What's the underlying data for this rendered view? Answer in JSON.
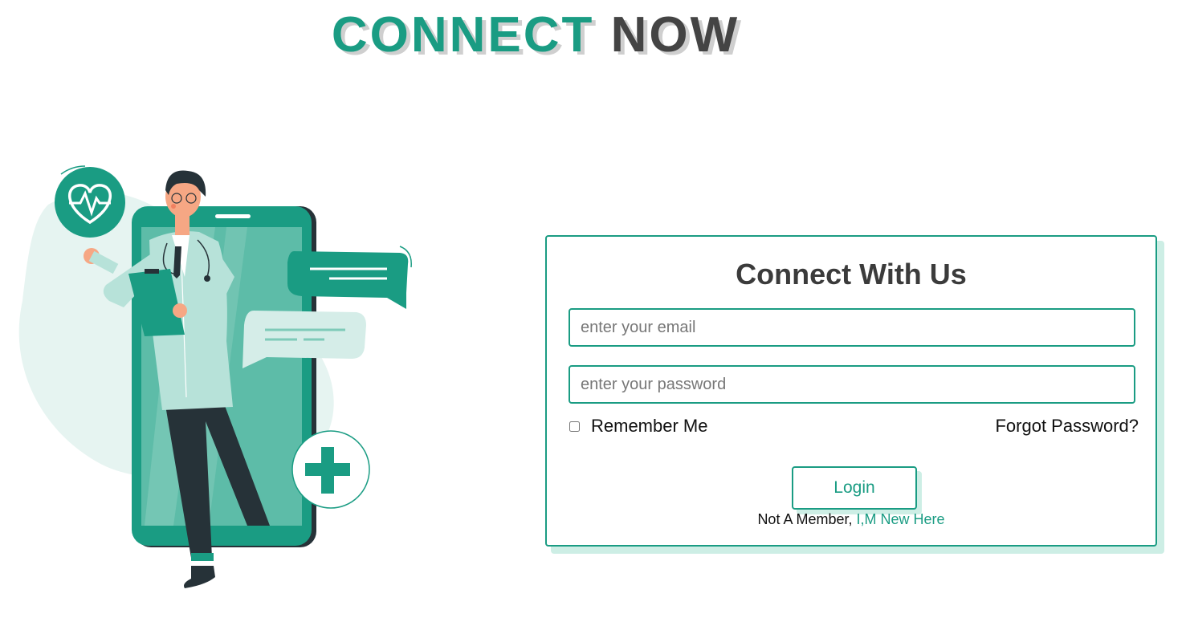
{
  "header": {
    "brand_word1": "CONNECT",
    "brand_word2": "NOW"
  },
  "form": {
    "title": "Connect With Us",
    "email_placeholder": "enter your email",
    "email_value": "",
    "password_placeholder": "enter your password",
    "password_value": "",
    "remember_label": "Remember Me",
    "remember_checked": false,
    "forgot_label": "Forgot Password?",
    "login_label": "Login",
    "signup_prefix": "Not A Member,",
    "signup_link": "I,M New Here"
  },
  "illustration": {
    "subject": "doctor-with-phone",
    "icons": [
      "heart-pulse-icon",
      "chat-bubble-icon",
      "medical-cross-icon"
    ]
  },
  "colors": {
    "accent": "#1a9c83",
    "accent_light": "#cdeee5",
    "heading_dark": "#444444",
    "text": "#111111"
  }
}
